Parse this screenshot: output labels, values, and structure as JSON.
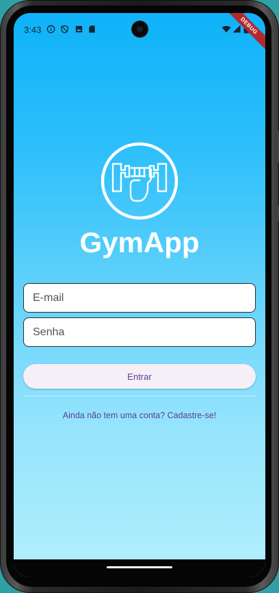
{
  "status_bar": {
    "time": "3:43",
    "icons": [
      "info-icon",
      "shield-icon",
      "photo-icon",
      "sd-card-icon"
    ],
    "right_icons": [
      "wifi-icon",
      "signal-icon",
      "battery-icon"
    ],
    "debug_label": "DEBUG"
  },
  "app": {
    "title": "GymApp",
    "logo": "dumbbell-fist-icon"
  },
  "form": {
    "email_placeholder": "E-mail",
    "password_placeholder": "Senha",
    "login_label": "Entrar",
    "signup_text": "Ainda não tem uma conta? Cadastre-se!"
  },
  "colors": {
    "gradient_top": "#0fb2f9",
    "gradient_bottom": "#b3f0fd",
    "title": "#ffffff",
    "button_bg": "#f5eff8",
    "accent_text": "#5b3d8e",
    "debug_ribbon": "#b1292f"
  }
}
